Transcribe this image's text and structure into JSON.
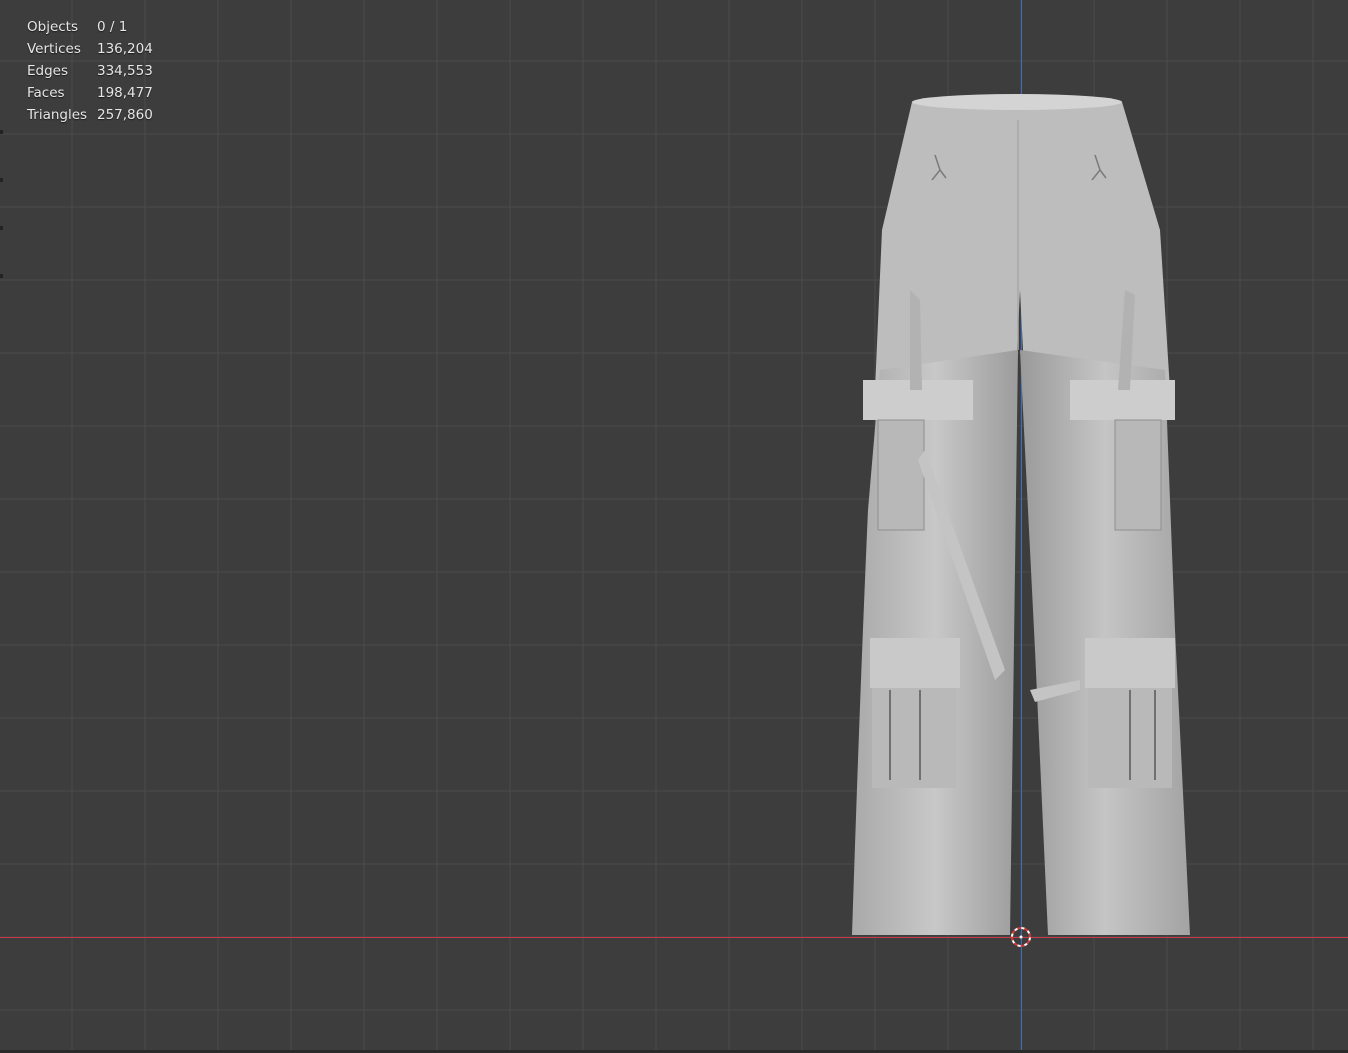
{
  "stats": {
    "rows": [
      {
        "label": "Objects",
        "value": "0 / 1"
      },
      {
        "label": "Vertices",
        "value": "136,204"
      },
      {
        "label": "Edges",
        "value": "334,553"
      },
      {
        "label": "Faces",
        "value": "198,477"
      },
      {
        "label": "Triangles",
        "value": "257,860"
      }
    ]
  },
  "colors": {
    "background": "#3d3d3d",
    "grid": "#4a4a4a",
    "x_axis": "#c9374a",
    "z_axis": "#3f6dbd",
    "mesh": "#bdbdbd"
  },
  "icons": {
    "origin": "3d-cursor-icon"
  }
}
